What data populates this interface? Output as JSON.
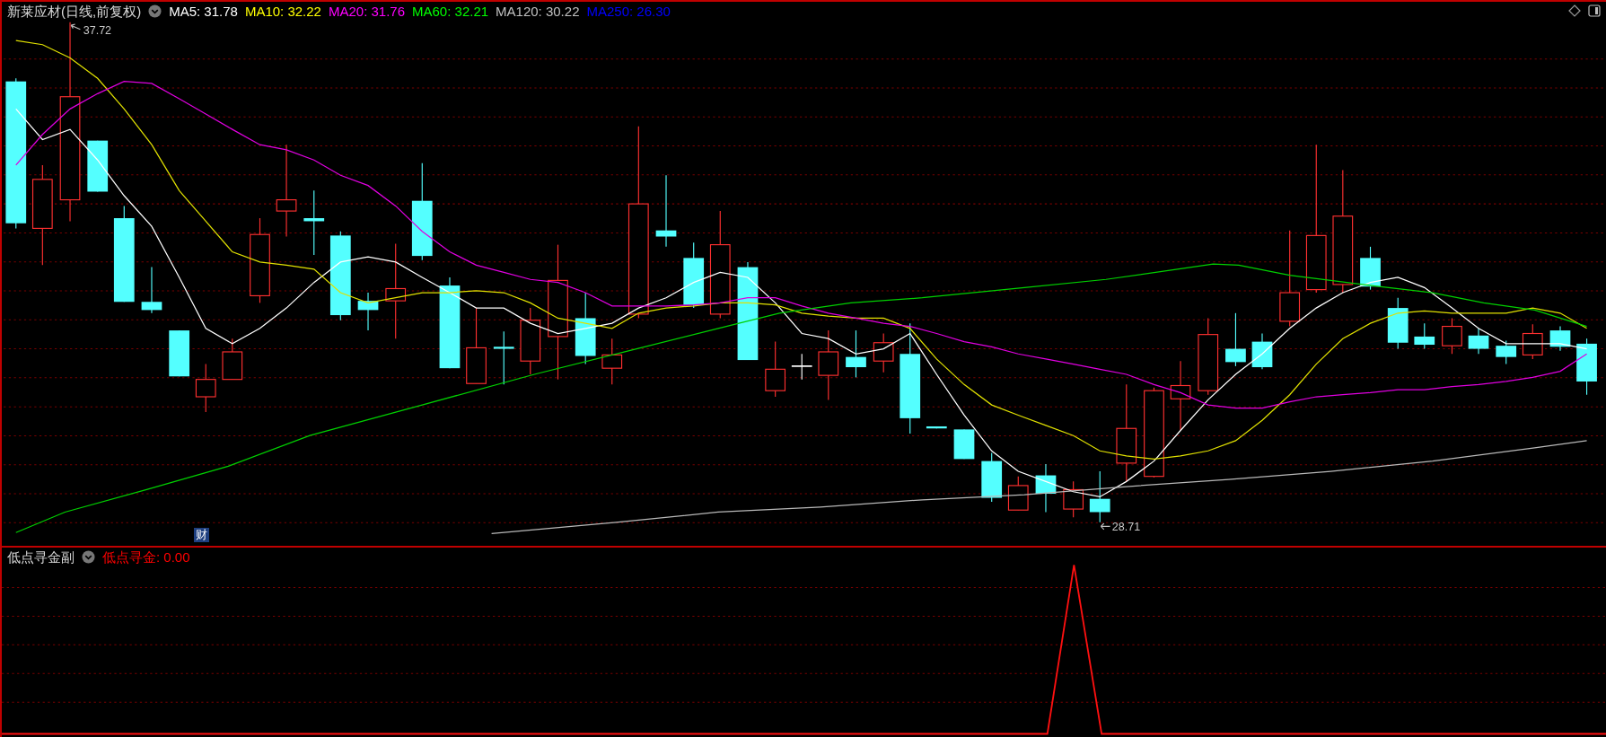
{
  "chart": {
    "title": "新莱应材(日线,前复权)",
    "indicators": [
      {
        "label": "MA5: 31.78",
        "color": "#ffffff"
      },
      {
        "label": "MA10: 32.22",
        "color": "#ffff00"
      },
      {
        "label": "MA20: 31.76",
        "color": "#ff00ff"
      },
      {
        "label": "MA60: 32.21",
        "color": "#00ff00"
      },
      {
        "label": "MA120: 30.22",
        "color": "#c0c0c0"
      },
      {
        "label": "MA250: 26.30",
        "color": "#0000ff"
      }
    ],
    "high_label": "37.72",
    "low_label": "28.71",
    "badge": "财"
  },
  "sub_chart": {
    "title": "低点寻金副",
    "indicators": [
      {
        "label": "低点寻金: 0.00",
        "color": "#ff0000"
      }
    ]
  }
}
